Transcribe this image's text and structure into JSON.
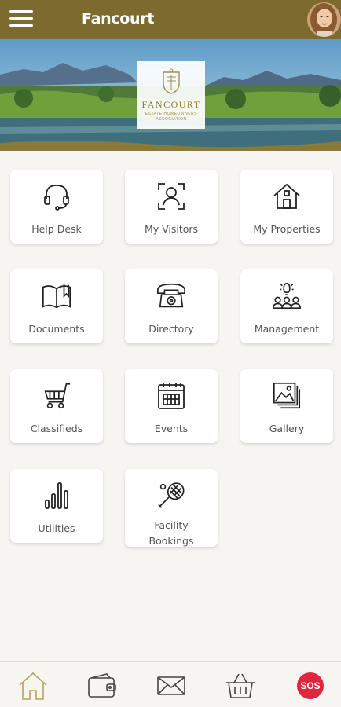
{
  "header": {
    "title": "Fancourt",
    "menu_icon": "hamburger-icon",
    "avatar": "user-avatar"
  },
  "banner": {
    "logo_name": "FANCOURT",
    "logo_sub": "ESTATE HOMEOWNERS ASSOCIATION"
  },
  "tiles": [
    {
      "label": "Help Desk",
      "icon": "headset-icon"
    },
    {
      "label": "My Visitors",
      "icon": "face-scan-icon"
    },
    {
      "label": "My Properties",
      "icon": "house-icon"
    },
    {
      "label": "Documents",
      "icon": "book-icon"
    },
    {
      "label": "Directory",
      "icon": "telephone-icon"
    },
    {
      "label": "Management",
      "icon": "team-idea-icon"
    },
    {
      "label": "Classifieds",
      "icon": "shopping-cart-icon"
    },
    {
      "label": "Events",
      "icon": "calendar-icon"
    },
    {
      "label": "Gallery",
      "icon": "gallery-icon"
    },
    {
      "label": "Utilities",
      "icon": "bar-chart-icon"
    },
    {
      "label": "Facility Bookings",
      "icon": "tennis-racket-icon"
    }
  ],
  "bottom_nav": [
    {
      "icon": "home-icon"
    },
    {
      "icon": "wallet-icon"
    },
    {
      "icon": "mail-icon"
    },
    {
      "icon": "basket-icon"
    },
    {
      "icon": "sos-icon",
      "label": "SOS"
    }
  ],
  "colors": {
    "header": "#7c6a2f",
    "background": "#f7f5f2",
    "sos": "#e0263c",
    "home_active": "#b9a15a"
  }
}
